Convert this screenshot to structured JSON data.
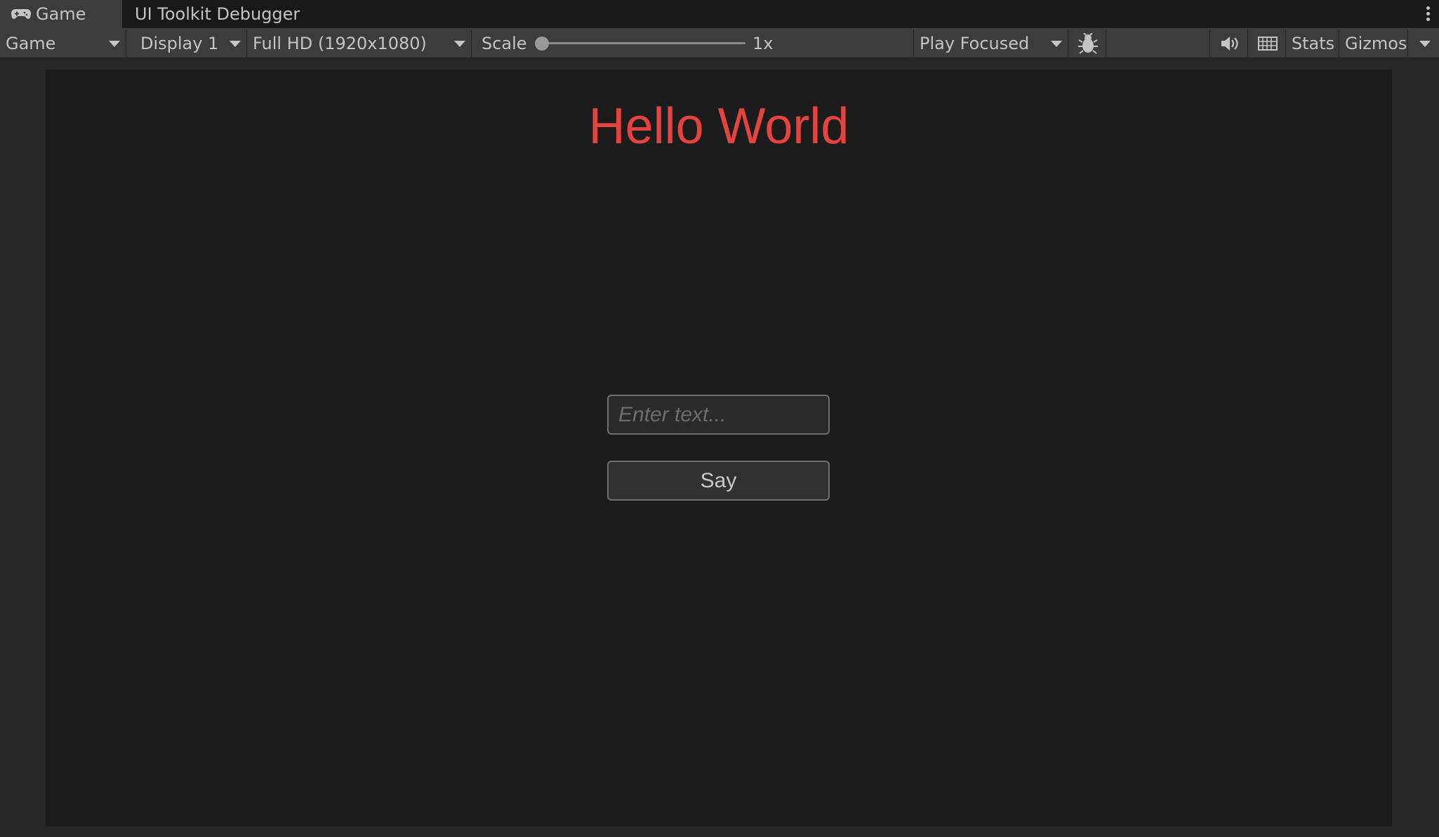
{
  "tabs": [
    {
      "label": "Game",
      "icon": "gamepad-icon",
      "active": true
    },
    {
      "label": "UI Toolkit Debugger",
      "active": false
    }
  ],
  "toolbar": {
    "view_mode": "Game",
    "display": "Display 1",
    "resolution": "Full HD (1920x1080)",
    "scale_label": "Scale",
    "scale_value": "1x",
    "scale_level": 0,
    "play_mode": "Play Focused",
    "stats_label": "Stats",
    "gizmos_label": "Gizmos"
  },
  "game_view": {
    "title": "Hello World",
    "input_placeholder": "Enter text...",
    "say_button": "Say"
  },
  "colors": {
    "title": "#e5443e",
    "viewport_bg": "#1c1c1c",
    "toolbar_bg": "#3c3c3c"
  }
}
